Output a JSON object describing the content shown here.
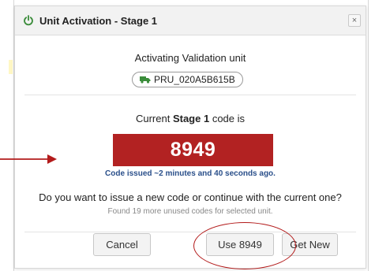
{
  "dialog": {
    "title": "Unit Activation - Stage 1",
    "close_symbol": "×",
    "activating_text": "Activating Validation unit",
    "unit_id": "PRU_020A5B615B",
    "code_intro_prefix": "Current",
    "code_intro_stage": "Stage 1",
    "code_intro_suffix": "code is",
    "code": "8949",
    "issued_text": "Code issued ~2 minutes and 40 seconds ago.",
    "question": "Do you want to issue a new code or continue with the current one?",
    "found_text": "Found 19 more unused codes for selected unit.",
    "buttons": {
      "cancel": "Cancel",
      "use": "Use 8949",
      "get_new": "Get New"
    }
  },
  "icons": {
    "title_icon": "power-icon",
    "unit_icon": "truck-icon",
    "close_icon": "close-icon"
  },
  "colors": {
    "code_background": "#b22222",
    "issued_text": "#2a4f8a",
    "annotation": "#b31b1b",
    "truck": "#3a8c3a",
    "power_icon": "#3a8c3a"
  }
}
